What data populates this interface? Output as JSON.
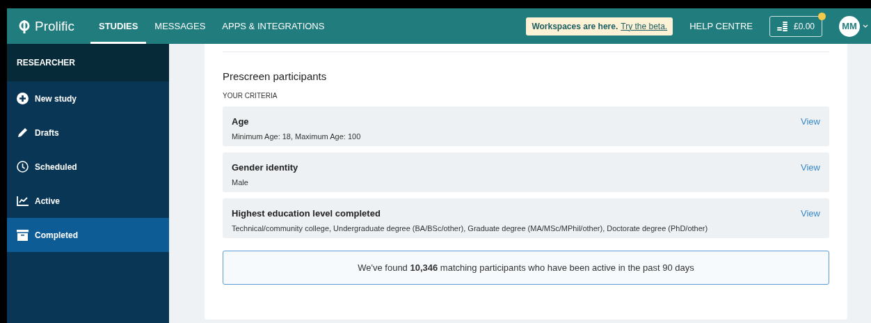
{
  "header": {
    "logo": "Prolific",
    "nav": [
      {
        "label": "STUDIES",
        "selected": true
      },
      {
        "label": "MESSAGES",
        "selected": false
      },
      {
        "label": "APPS & INTEGRATIONS",
        "selected": false
      }
    ],
    "banner": {
      "text": "Workspaces are here.",
      "link": "Try the beta."
    },
    "help": "HELP CENTRE",
    "balance": "£0.00",
    "balance_notification": true,
    "avatar": "MM"
  },
  "sidebar": {
    "title": "RESEARCHER",
    "items": [
      {
        "label": "New study",
        "selected": false
      },
      {
        "label": "Drafts",
        "selected": false
      },
      {
        "label": "Scheduled",
        "selected": false
      },
      {
        "label": "Active",
        "selected": false
      },
      {
        "label": "Completed",
        "selected": true
      }
    ]
  },
  "main": {
    "title": "Prescreen participants",
    "subtitle": "YOUR CRITERIA",
    "criteria": [
      {
        "name": "Age",
        "value": "Minimum Age: 18, Maximum Age: 100",
        "action": "View"
      },
      {
        "name": "Gender identity",
        "value": "Male",
        "action": "View"
      },
      {
        "name": "Highest education level completed",
        "value": "Technical/community college, Undergraduate degree (BA/BSc/other), Graduate degree (MA/MSc/MPhil/other), Doctorate degree (PhD/other)",
        "action": "View"
      }
    ],
    "result": "We've found **10,346** matching participants who have been active in the past 90 days"
  }
}
